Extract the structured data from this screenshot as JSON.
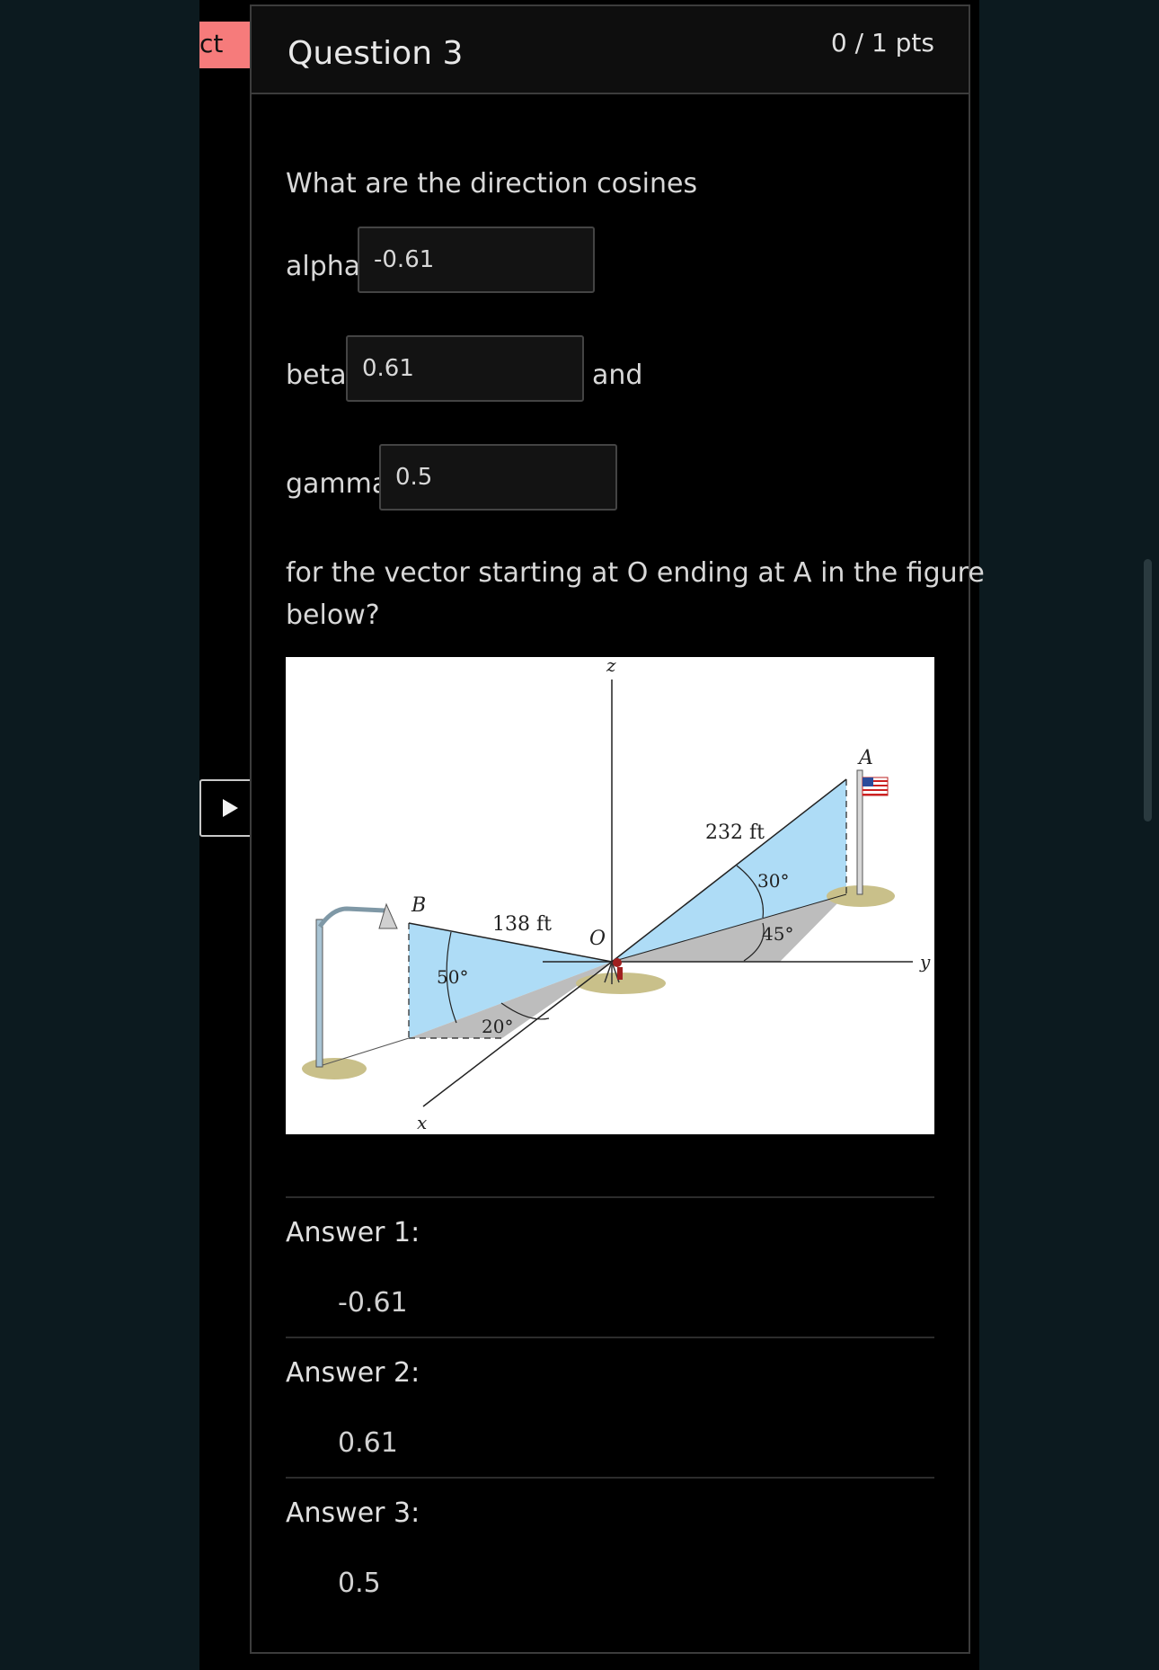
{
  "flag_tab": {
    "text": "ct"
  },
  "question": {
    "title": "Question 3",
    "points": "0 / 1 pts",
    "prompt": "What are the direction cosines",
    "fields": [
      {
        "label": "alpha",
        "value": "-0.61"
      },
      {
        "label": "beta",
        "value": "0.61",
        "suffix": "and"
      },
      {
        "label": "gamma",
        "value": "0.5"
      }
    ],
    "prompt_line1": "for the vector starting at O ending at A in the figure",
    "prompt_line2": "below?"
  },
  "figure": {
    "labels": {
      "z": "z",
      "y": "y",
      "x": "x",
      "a": "A",
      "b": "B",
      "o": "O",
      "len_oa": "232 ft",
      "len_ob": "138 ft",
      "ang30": "30°",
      "ang45": "45°",
      "ang50": "50°",
      "ang20": "20°"
    },
    "colors": {
      "plane_blue": "#aedcf6",
      "plane_gray": "#bdbdbd",
      "ground": "#c9c08a"
    }
  },
  "answers": [
    {
      "label": "Answer 1:",
      "value": "-0.61"
    },
    {
      "label": "Answer 2:",
      "value": "0.61"
    },
    {
      "label": "Answer 3:",
      "value": "0.5"
    }
  ]
}
